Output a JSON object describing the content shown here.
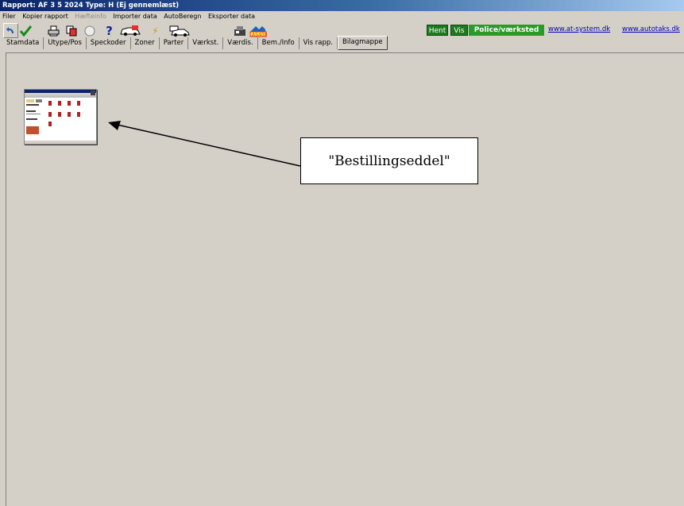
{
  "window": {
    "title": "Rapport: AF 3 5 2024  Type: H  (Ej gennemlæst)"
  },
  "menu": [
    {
      "label": "Filer",
      "enabled": true
    },
    {
      "label": "Kopier rapport",
      "enabled": true
    },
    {
      "label": "Hæfteinfo",
      "enabled": false
    },
    {
      "label": "Importer data",
      "enabled": true
    },
    {
      "label": "AutoBeregn",
      "enabled": true
    },
    {
      "label": "Eksporter data",
      "enabled": true
    }
  ],
  "toolbar": {
    "icons": [
      "undo-icon",
      "check-icon",
      "print-icon",
      "copy-icon",
      "circle-icon",
      "help-icon",
      "car-icon",
      "edit-icon",
      "car-view-icon",
      "stamp-icon",
      "as400-icon"
    ],
    "hent_label": "Hent",
    "vis_label": "Vis",
    "police_label": "Police/værksted",
    "link1": "www.at-system.dk",
    "link2": "www.autotaks.dk"
  },
  "tabs": [
    "Stamdata",
    "Utype/Pos",
    "Speckoder",
    "Zoner",
    "Parter",
    "Værkst.",
    "Værdis.",
    "Bem./Info",
    "Vis rapp.",
    "Bilagmappe"
  ],
  "active_tab": "Bilagmappe",
  "callout": {
    "text": "\"Bestillingseddel\""
  },
  "colors": {
    "accent_green": "#2a9a2a",
    "title_blue": "#0a246a",
    "link": "#0000c0"
  }
}
